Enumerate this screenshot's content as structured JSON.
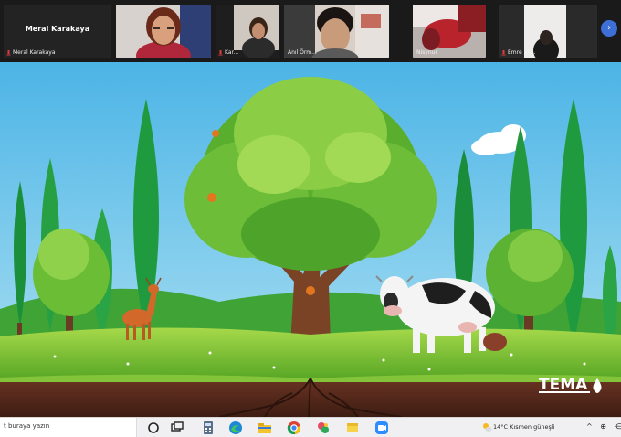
{
  "meeting": {
    "participants": [
      {
        "tile_text": "Meral Karakaya",
        "name": "Meral Karakaya",
        "muted": true
      },
      {
        "tile_text": "",
        "name": "",
        "muted": false
      },
      {
        "tile_text": "",
        "name": "Kar...",
        "muted": true
      },
      {
        "tile_text": "",
        "name": "Anıl Örm...",
        "muted": false
      },
      {
        "tile_text": "",
        "name": "Nisynur",
        "muted": false
      },
      {
        "tile_text": "",
        "name": "Emre ak...",
        "muted": true
      }
    ],
    "next_page_icon": "chevron-right-icon"
  },
  "shared_screen": {
    "logo_text": "TEMA",
    "scene_items": [
      "sky",
      "cloud",
      "cypress-trees",
      "oak-tree",
      "deer",
      "cow",
      "grass-meadow",
      "soil-with-roots"
    ]
  },
  "taskbar": {
    "search_placeholder": "t buraya yazın",
    "pinned_icons": [
      "start-icon",
      "task-view-icon",
      "calculator-icon",
      "edge-icon",
      "file-explorer-icon",
      "chrome-icon",
      "paint-icon",
      "sticky-notes-icon",
      "zoom-icon"
    ],
    "weather_text": "14°C  Kısmen güneşli",
    "tray_text": "^ ⊕ ⋲"
  },
  "colors": {
    "strip_bg": "#1a1a1a",
    "sky": "#62c2e9",
    "grass": "#84c43a",
    "tree_dark": "#1c8f3b",
    "tree_light": "#7cc43a",
    "soil": "#5b2e1e",
    "zoom_blue": "#3d6fd6"
  }
}
